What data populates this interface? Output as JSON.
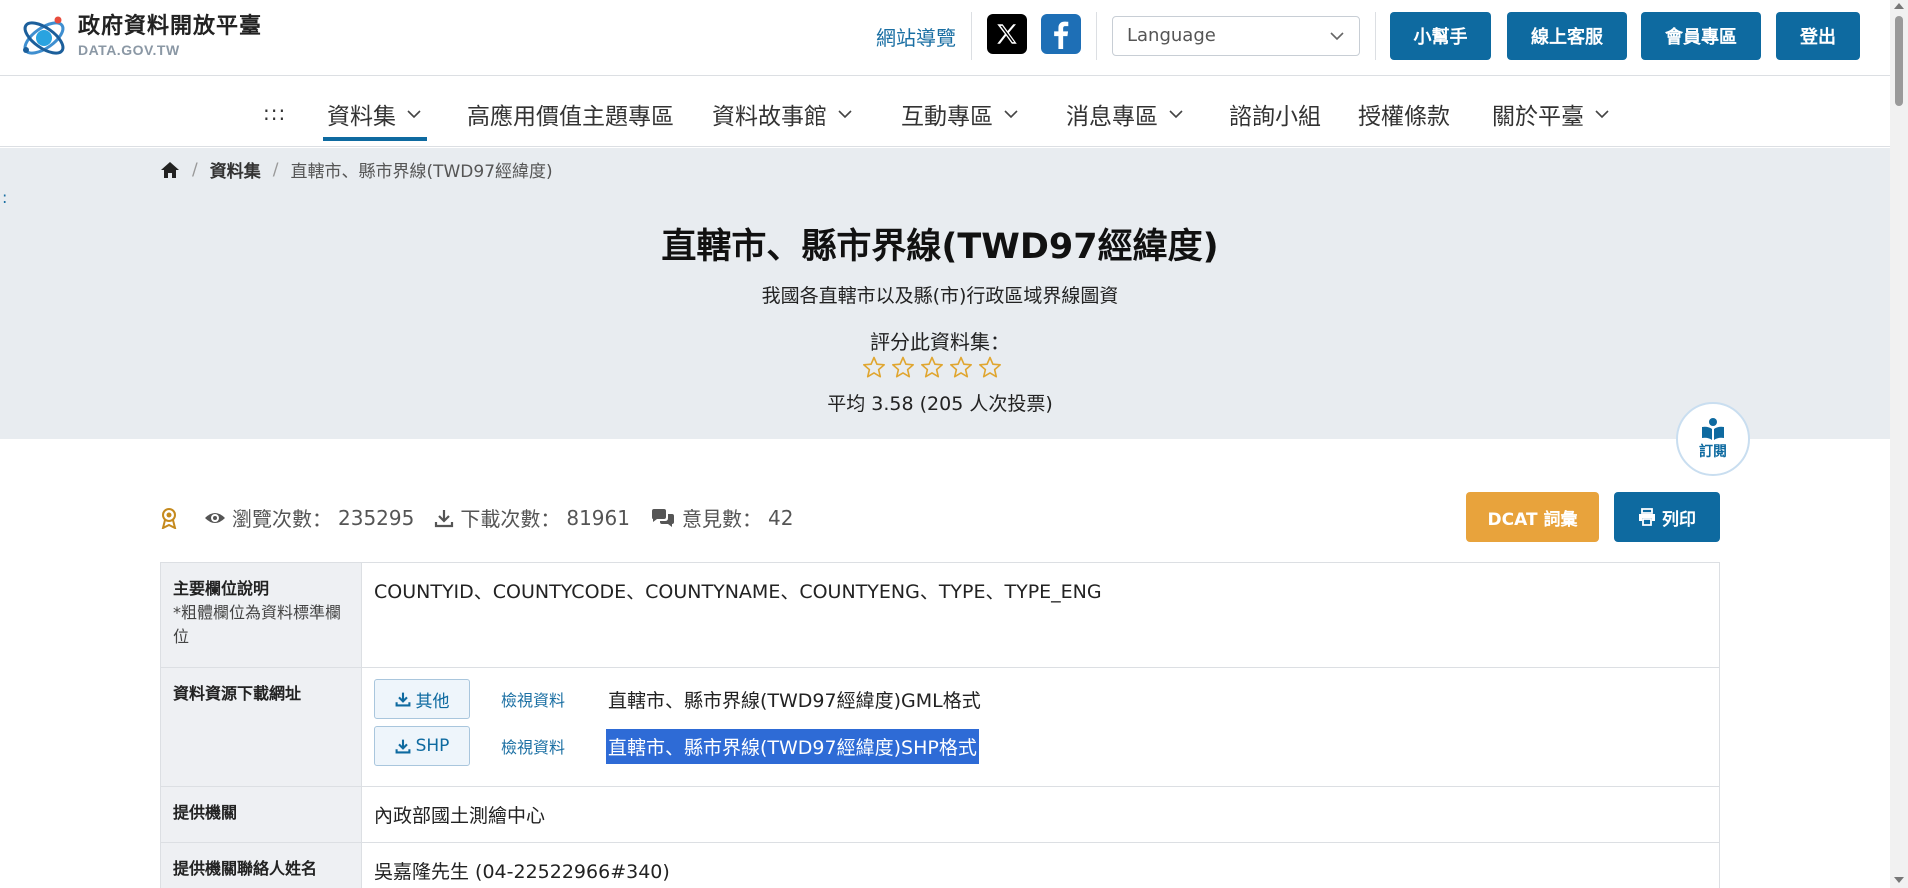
{
  "header": {
    "logo_title": "政府資料開放平臺",
    "logo_sub": "DATA.GOV.TW",
    "sitemap": "網站導覽",
    "language_placeholder": "Language",
    "buttons": [
      "小幫手",
      "線上客服",
      "會員專區",
      "登出"
    ]
  },
  "nav": {
    "grid": ":::",
    "items": [
      "資料集",
      "高應用價值主題專區",
      "資料故事館",
      "互動專區",
      "消息專區",
      "諮詢小組",
      "授權條款",
      "關於平臺"
    ]
  },
  "breadcrumb": {
    "items": [
      "資料集",
      "直轄市、縣市界線(TWD97經緯度)"
    ]
  },
  "hero": {
    "colon": ":",
    "title": "直轄市、縣市界線(TWD97經緯度)",
    "subtitle": "我國各直轄市以及縣(市)行政區域界線圖資",
    "rate_label": "評分此資料集：",
    "stars_filled": 0,
    "stars_total": 5,
    "rate_avg": "平均 3.58 (205 人次投票)"
  },
  "subscribe": {
    "label": "訂閱"
  },
  "stats": {
    "views_label": "瀏覽次數：",
    "views": "235295",
    "downloads_label": "下載次數：",
    "downloads": "81961",
    "comments_label": "意見數：",
    "comments": "42"
  },
  "actions": {
    "dcat": "DCAT 詞彙",
    "print": "列印"
  },
  "table": {
    "fields_key": "主要欄位說明",
    "fields_note": "*粗體欄位為資料標準欄位",
    "fields_value": "COUNTYID、COUNTYCODE、COUNTYNAME、COUNTYENG、TYPE、TYPE_ENG",
    "resources_key": "資料資源下載網址",
    "resources": [
      {
        "format": "其他",
        "view": "檢視資料",
        "name": "直轄市、縣市界線(TWD97經緯度)GML格式"
      },
      {
        "format": "SHP",
        "view": "檢視資料",
        "name": "直轄市、縣市界線(TWD97經緯度)SHP格式"
      }
    ],
    "provider_key": "提供機關",
    "provider_value": "內政部國土測繪中心",
    "contact_key": "提供機關聯絡人姓名",
    "contact_value": "吳嘉隆先生 (04-22522966#340)"
  },
  "colors": {
    "primary": "#0e6aa0",
    "accent": "#e8a33c",
    "hero_bg": "#e8ecf0",
    "selection": "#2e6bd6"
  }
}
